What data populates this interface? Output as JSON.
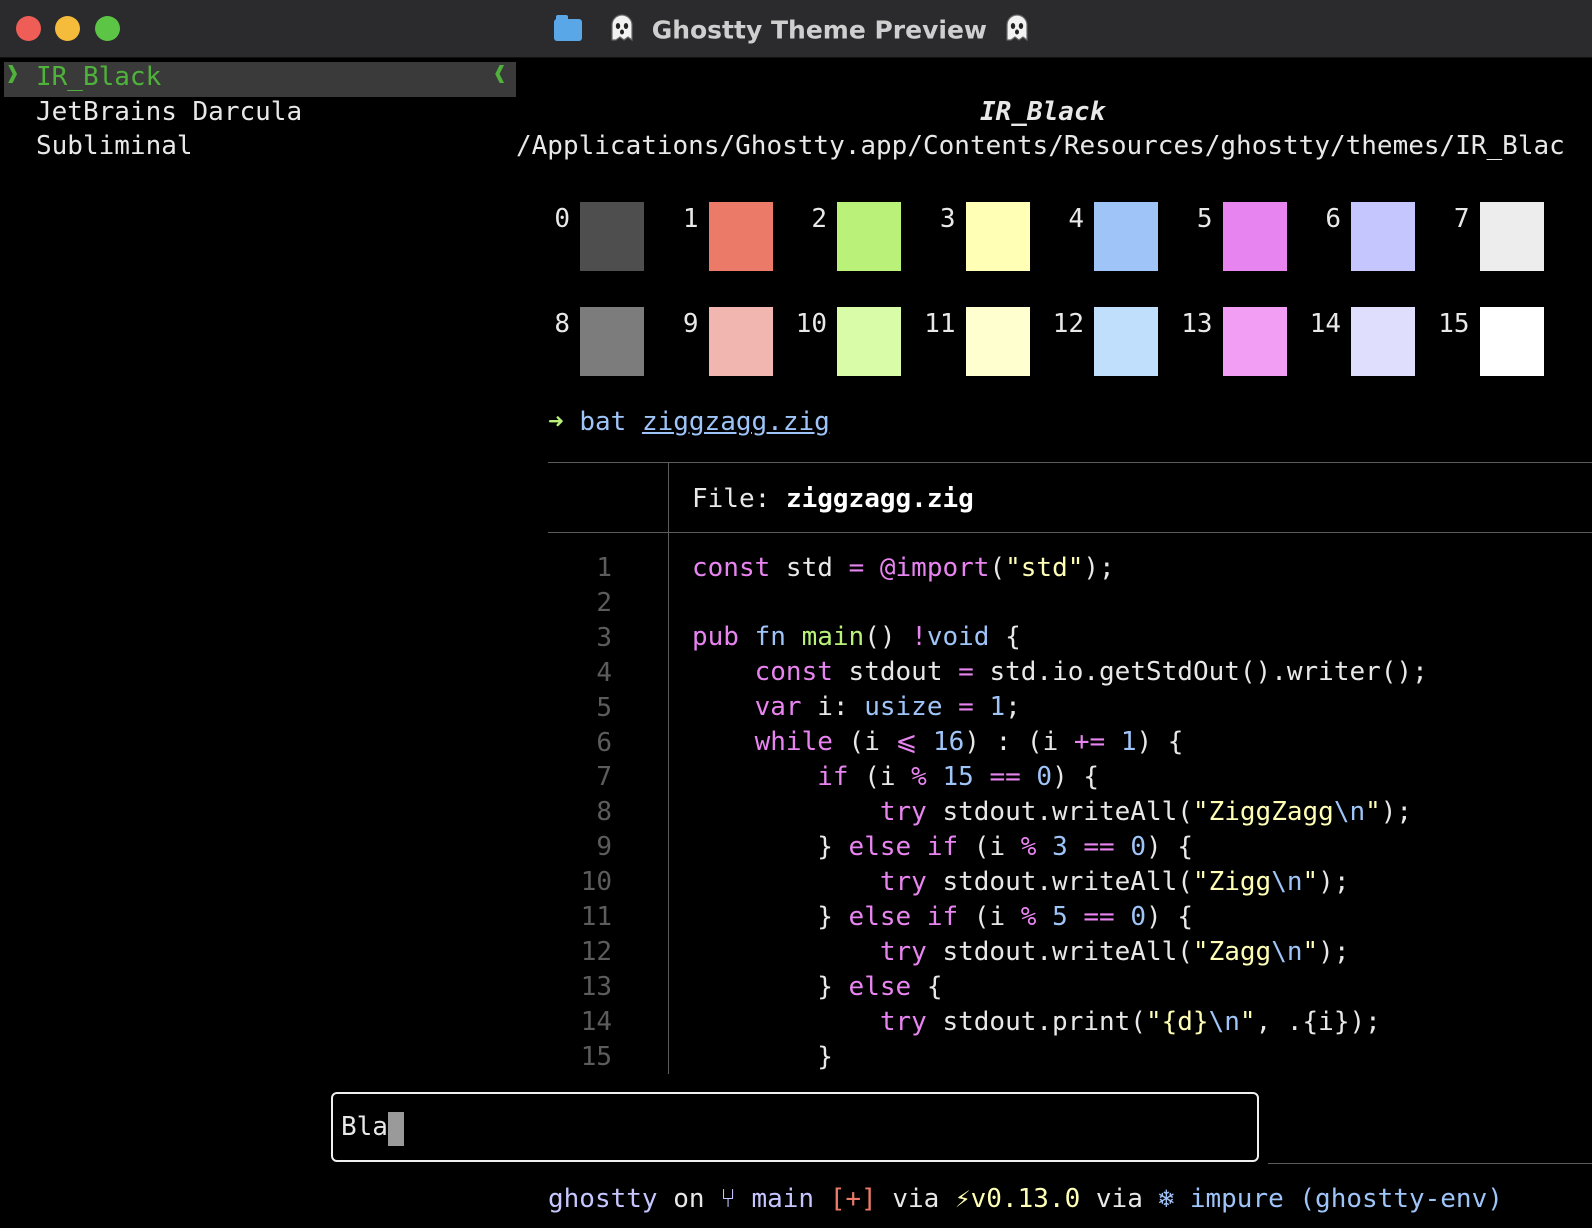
{
  "window": {
    "title": "Ghostty Theme Preview"
  },
  "theme_list": {
    "items": [
      "IR_Black",
      "JetBrains Darcula",
      "Subliminal"
    ],
    "selected_marker_left": "❱",
    "selected_marker_right": "❰"
  },
  "preview": {
    "theme_name": "IR_Black",
    "theme_path": "/Applications/Ghostty.app/Contents/Resources/ghostty/themes/IR_Blac",
    "palette": [
      {
        "label": "0",
        "color": "#4e4e4e"
      },
      {
        "label": "1",
        "color": "#ec7a69"
      },
      {
        "label": "2",
        "color": "#b9f179"
      },
      {
        "label": "3",
        "color": "#ffffb5"
      },
      {
        "label": "4",
        "color": "#9ec4f8"
      },
      {
        "label": "5",
        "color": "#e884f0"
      },
      {
        "label": "6",
        "color": "#c6c6fe"
      },
      {
        "label": "7",
        "color": "#eeedee"
      },
      {
        "label": "8",
        "color": "#7c7c7c"
      },
      {
        "label": "9",
        "color": "#f1b6b0"
      },
      {
        "label": "10",
        "color": "#d9fca8"
      },
      {
        "label": "11",
        "color": "#ffffcf"
      },
      {
        "label": "12",
        "color": "#c0dffd"
      },
      {
        "label": "13",
        "color": "#f19ef4"
      },
      {
        "label": "14",
        "color": "#dfdefc"
      },
      {
        "label": "15",
        "color": "#ffffff"
      }
    ],
    "command": {
      "prompt": "➜",
      "cmd": "bat",
      "arg": "ziggzagg.zig"
    },
    "file_header": {
      "label": "File:",
      "name": "ziggzagg.zig"
    },
    "line_numbers": [
      "1",
      "2",
      "3",
      "4",
      "5",
      "6",
      "7",
      "8",
      "9",
      "10",
      "11",
      "12",
      "13",
      "14",
      "15"
    ]
  },
  "search": {
    "value": "Bla"
  },
  "status": {
    "dir": "ghostty",
    "on": "on",
    "branch": "main",
    "changes": "[+]",
    "via1": "via",
    "version": "v0.13.0",
    "via2": "via",
    "env": "impure (ghostty-env)"
  },
  "colors": {
    "selected_text": "#4fb33b",
    "selection_bg": "#3a3a3a"
  }
}
